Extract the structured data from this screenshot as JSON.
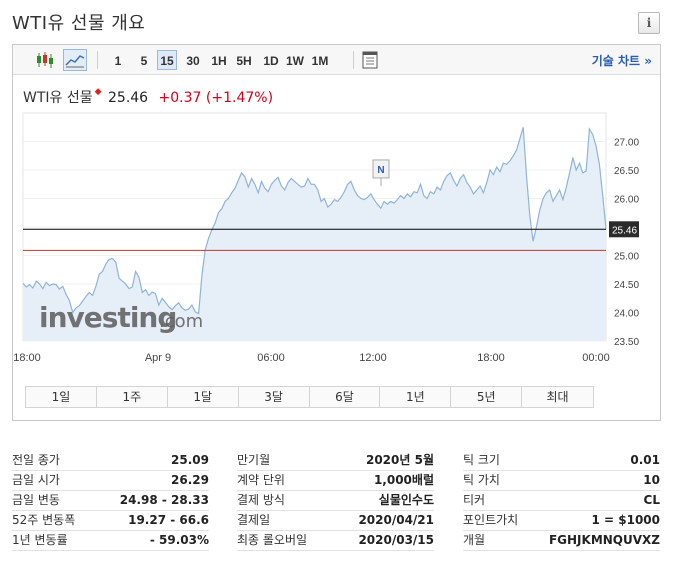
{
  "page": {
    "title": "WTI유 선물 개요"
  },
  "toolbar": {
    "intervals": [
      "1",
      "5",
      "15",
      "30",
      "1H",
      "5H",
      "1D",
      "1W",
      "1M"
    ],
    "active_interval": "15",
    "tech_chart_label": "기술 차트 »"
  },
  "quote": {
    "name": "WTI유 선물",
    "price": "25.46",
    "change": "+0.37",
    "change_pct": "(+1.47%)"
  },
  "chart_data": {
    "type": "area",
    "x_tick_labels": [
      "18:00",
      "Apr 9",
      "06:00",
      "12:00",
      "18:00",
      "00:00"
    ],
    "y_tick_labels": [
      "27.00",
      "26.50",
      "26.00",
      "25.50",
      "25.00",
      "24.50",
      "24.00",
      "23.50"
    ],
    "ylim": [
      23.5,
      27.5
    ],
    "current_price_label": "25.46",
    "reference_line": 25.09,
    "watermark_text": "investing",
    "watermark_suffix": ".com",
    "news_marker_label": "N",
    "colors": {
      "line": "#8fb4d8",
      "fill": "#e6eff8",
      "current_line": "#000000",
      "reference_line": "#c0392b",
      "label_bg": "#2b2b2b"
    },
    "values": [
      24.51,
      24.45,
      24.49,
      24.43,
      24.55,
      24.5,
      24.42,
      24.53,
      24.47,
      24.5,
      24.49,
      24.41,
      24.46,
      24.32,
      24.21,
      24.0,
      24.08,
      24.12,
      24.2,
      24.28,
      24.35,
      24.3,
      24.46,
      24.67,
      24.72,
      24.85,
      24.93,
      24.95,
      24.88,
      24.6,
      24.55,
      24.5,
      24.42,
      24.45,
      24.72,
      24.62,
      24.35,
      24.4,
      24.3,
      24.36,
      24.33,
      24.13,
      24.25,
      24.18,
      24.1,
      24.05,
      24.12,
      24.17,
      24.08,
      24.04,
      24.06,
      24.13,
      24.01,
      23.98,
      24.65,
      25.1,
      25.3,
      25.45,
      25.57,
      25.75,
      25.82,
      25.95,
      26.0,
      26.1,
      26.18,
      26.32,
      26.45,
      26.38,
      26.2,
      26.35,
      26.25,
      26.1,
      26.3,
      26.18,
      26.12,
      26.25,
      26.32,
      26.37,
      26.22,
      26.15,
      26.28,
      26.35,
      26.3,
      26.25,
      26.2,
      26.22,
      26.35,
      26.25,
      26.25,
      26.15,
      25.95,
      26.0,
      25.85,
      25.9,
      25.98,
      25.95,
      26.02,
      26.12,
      26.25,
      26.3,
      26.15,
      26.05,
      26.0,
      25.98,
      26.02,
      26.08,
      25.98,
      25.9,
      25.83,
      25.95,
      25.9,
      25.95,
      25.92,
      25.98,
      26.05,
      26.0,
      26.08,
      26.03,
      26.12,
      26.1,
      26.25,
      26.05,
      26.0,
      26.12,
      26.08,
      26.2,
      26.15,
      26.3,
      26.4,
      26.45,
      26.32,
      26.22,
      26.35,
      26.42,
      26.28,
      26.2,
      26.08,
      26.15,
      26.22,
      26.1,
      26.28,
      26.5,
      26.42,
      26.55,
      26.47,
      26.62,
      26.6,
      26.66,
      26.75,
      26.85,
      27.05,
      27.25,
      26.4,
      25.7,
      25.25,
      25.5,
      25.8,
      26.0,
      26.1,
      26.15,
      25.95,
      26.05,
      26.15,
      25.98,
      26.2,
      26.45,
      26.72,
      26.5,
      26.62,
      26.45,
      26.48,
      27.22,
      27.12,
      26.92,
      26.6,
      26.05,
      25.46
    ]
  },
  "periods": [
    "1일",
    "1주",
    "1달",
    "3달",
    "6달",
    "1년",
    "5년",
    "최대"
  ],
  "stats": {
    "col1": [
      {
        "label": "전일 종가",
        "value": "25.09"
      },
      {
        "label": "금일 시가",
        "value": "26.29"
      },
      {
        "label": "금일 변동",
        "value": "24.98 - 28.33"
      },
      {
        "label": "52주 변동폭",
        "value": "19.27 - 66.6"
      },
      {
        "label": "1년 변동률",
        "value": "- 59.03%"
      }
    ],
    "col2": [
      {
        "label": "만기월",
        "value": "2020년 5월"
      },
      {
        "label": "계약 단위",
        "value": "1,000배럴"
      },
      {
        "label": "결제 방식",
        "value": "실물인수도"
      },
      {
        "label": "결제일",
        "value": "2020/04/21"
      },
      {
        "label": "최종 롤오버일",
        "value": "2020/03/15"
      }
    ],
    "col3": [
      {
        "label": "틱 크기",
        "value": "0.01"
      },
      {
        "label": "틱 가치",
        "value": "10"
      },
      {
        "label": "티커",
        "value": "CL"
      },
      {
        "label": "포인트가치",
        "value": "1 = $1000"
      },
      {
        "label": "개월",
        "value": "FGHJKMNQUVXZ"
      }
    ]
  }
}
